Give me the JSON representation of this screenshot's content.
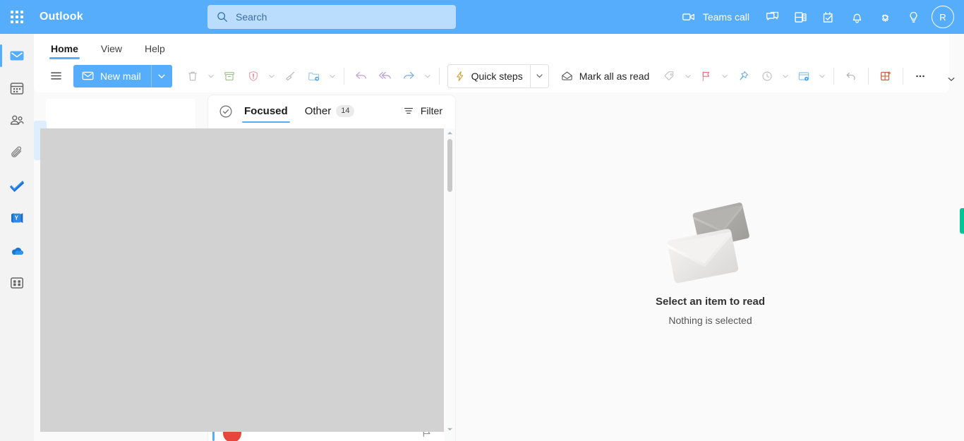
{
  "header": {
    "waffle_name": "app-launcher",
    "brand": "Outlook",
    "search": {
      "placeholder": "Search",
      "value": ""
    },
    "teams_call_label": "Teams call",
    "icons": [
      {
        "name": "teams-call-icon",
        "label": "Teams call"
      },
      {
        "name": "chat-icon",
        "label": "Chat"
      },
      {
        "name": "outlook-addressbook-icon",
        "label": "Address book"
      },
      {
        "name": "tasks-icon",
        "label": "My day"
      },
      {
        "name": "notifications-bell-icon",
        "label": "Notifications"
      },
      {
        "name": "settings-gear-icon",
        "label": "Settings"
      },
      {
        "name": "tips-lightbulb-icon",
        "label": "Tips"
      }
    ],
    "avatar_initial": "R",
    "accent_color": "#55adfc",
    "search_bg_color": "#badcfd"
  },
  "left_rail": {
    "items": [
      {
        "name": "rail-item-mail",
        "label": "Mail",
        "active": true
      },
      {
        "name": "rail-item-calendar",
        "label": "Calendar",
        "active": false
      },
      {
        "name": "rail-item-people",
        "label": "People",
        "active": false
      },
      {
        "name": "rail-item-files",
        "label": "Files",
        "active": false
      },
      {
        "name": "rail-item-todo",
        "label": "To Do",
        "active": false
      },
      {
        "name": "rail-item-viva-engage",
        "label": "Viva Engage",
        "active": false
      },
      {
        "name": "rail-item-onedrive",
        "label": "OneDrive",
        "active": false
      },
      {
        "name": "rail-item-more-apps",
        "label": "More apps",
        "active": false
      }
    ]
  },
  "ribbon": {
    "tabs": [
      {
        "label": "Home",
        "active": true
      },
      {
        "label": "View",
        "active": false
      },
      {
        "label": "Help",
        "active": false
      }
    ],
    "toolbar": {
      "hamburger_label": "Toggle navigation pane",
      "new_mail_label": "New mail",
      "new_mail_caret_label": "New mail options",
      "delete_label": "Delete",
      "archive_label": "Archive",
      "report_label": "Report",
      "sweep_label": "Sweep",
      "move_to_label": "Move to",
      "undo_label": "Undo",
      "reply_all_label": "Reply all",
      "forward_label": "Forward",
      "quick_steps_label": "Quick steps",
      "mark_all_read_label": "Mark all as read",
      "tag_label": "Tag",
      "flag_label": "Flag",
      "pin_label": "Pin",
      "snooze_label": "Snooze",
      "rules_label": "Rules",
      "undo_send_label": "Undo",
      "add_apps_label": "Apps",
      "more_label": "More options",
      "collapse_label": "Collapse ribbon"
    }
  },
  "message_list": {
    "focus_toggle_label": "Focused inbox toggle",
    "pivots": [
      {
        "label": "Focused",
        "active": true,
        "count": ""
      },
      {
        "label": "Other",
        "active": false,
        "count": "14"
      }
    ],
    "filter_label": "Filter",
    "partial_row_label": "",
    "scrollbar": {
      "up_label": "Scroll up",
      "down_label": "Scroll down"
    }
  },
  "reading_pane": {
    "empty_title": "Select an item to read",
    "empty_subtitle": "Nothing is selected"
  },
  "overlay": {
    "color": "#d2d2d2",
    "label": "loading-placeholder"
  },
  "edge_marker": {
    "color": "#00c795",
    "label": "edge-indicator"
  }
}
